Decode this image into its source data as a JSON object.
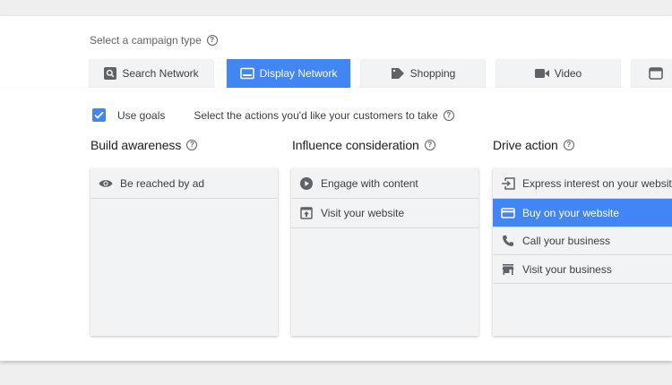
{
  "campaign_type": {
    "label": "Select a campaign type",
    "tabs": [
      {
        "label": "Search Network",
        "icon": "search-icon",
        "active": false
      },
      {
        "label": "Display Network",
        "icon": "display-icon",
        "active": true
      },
      {
        "label": "Shopping",
        "icon": "tag-icon",
        "active": false
      },
      {
        "label": "Video",
        "icon": "video-icon",
        "active": false
      },
      {
        "label": "",
        "icon": "app-icon",
        "active": false
      }
    ]
  },
  "goals": {
    "use_goals_label": "Use goals",
    "use_goals_checked": true,
    "description": "Select the actions you'd like your customers to take"
  },
  "columns": [
    {
      "title": "Build awareness",
      "items": [
        {
          "label": "Be reached by ad",
          "icon": "eye-icon",
          "selected": false
        }
      ]
    },
    {
      "title": "Influence consideration",
      "items": [
        {
          "label": "Engage with content",
          "icon": "play-circle-icon",
          "selected": false
        },
        {
          "label": "Visit your website",
          "icon": "open-in-browser-icon",
          "selected": false
        }
      ]
    },
    {
      "title": "Drive action",
      "items": [
        {
          "label": "Express interest on your website",
          "icon": "input-icon",
          "selected": false
        },
        {
          "label": "Buy on your website",
          "icon": "credit-card-icon",
          "selected": true
        },
        {
          "label": "Call your business",
          "icon": "phone-icon",
          "selected": false
        },
        {
          "label": "Visit your business",
          "icon": "store-icon",
          "selected": false
        }
      ]
    }
  ],
  "colors": {
    "accent": "#4285f4",
    "tab_bg": "#f1f3f4",
    "page_bg": "#efefef"
  }
}
